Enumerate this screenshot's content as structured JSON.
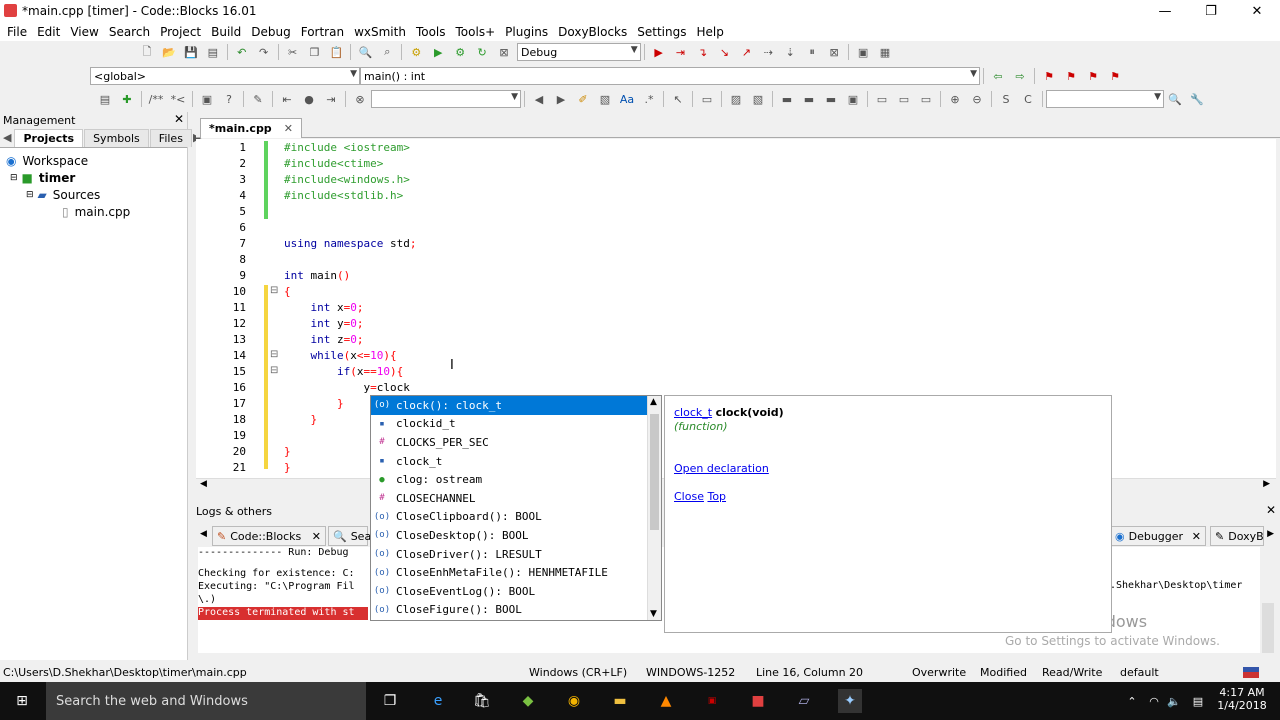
{
  "window": {
    "title": "*main.cpp [timer] - Code::Blocks 16.01",
    "minimize": "—",
    "maximize": "❐",
    "close": "✕"
  },
  "menu": [
    "File",
    "Edit",
    "View",
    "Search",
    "Project",
    "Build",
    "Debug",
    "Fortran",
    "wxSmith",
    "Tools",
    "Tools+",
    "Plugins",
    "DoxyBlocks",
    "Settings",
    "Help"
  ],
  "toolbar": {
    "build_target": "Debug",
    "scope": "<global>",
    "function": "main() : int"
  },
  "management": {
    "title": "Management",
    "tabs": [
      "Projects",
      "Symbols",
      "Files"
    ],
    "tree": {
      "workspace": "Workspace",
      "project": "timer",
      "folder": "Sources",
      "file": "main.cpp"
    }
  },
  "editor": {
    "tab": "*main.cpp",
    "lines": [
      {
        "n": "1",
        "html": "<span class='pp'>#include &lt;iostream&gt;</span>"
      },
      {
        "n": "2",
        "html": "<span class='pp'>#include&lt;ctime&gt;</span>"
      },
      {
        "n": "3",
        "html": "<span class='pp'>#include&lt;windows.h&gt;</span>"
      },
      {
        "n": "4",
        "html": "<span class='pp'>#include&lt;stdlib.h&gt;</span>"
      },
      {
        "n": "5",
        "html": ""
      },
      {
        "n": "6",
        "html": ""
      },
      {
        "n": "7",
        "html": "<span class='kw'>using namespace</span> std<span class='op'>;</span>"
      },
      {
        "n": "8",
        "html": ""
      },
      {
        "n": "9",
        "html": "<span class='kw'>int</span> main<span class='op'>()</span>"
      },
      {
        "n": "10",
        "html": "<span class='op'>{</span>"
      },
      {
        "n": "11",
        "html": "    <span class='kw'>int</span> x<span class='op'>=</span><span class='num'>0</span><span class='op'>;</span>"
      },
      {
        "n": "12",
        "html": "    <span class='kw'>int</span> y<span class='op'>=</span><span class='num'>0</span><span class='op'>;</span>"
      },
      {
        "n": "13",
        "html": "    <span class='kw'>int</span> z<span class='op'>=</span><span class='num'>0</span><span class='op'>;</span>"
      },
      {
        "n": "14",
        "html": "    <span class='kw'>while</span><span class='op'>(</span>x<span class='op'>&lt;=</span><span class='num'>10</span><span class='op'>){</span>"
      },
      {
        "n": "15",
        "html": "        <span class='kw'>if</span><span class='op'>(</span>x<span class='op'>==</span><span class='num'>10</span><span class='op'>){</span>"
      },
      {
        "n": "16",
        "html": "            y<span class='op'>=</span>clock"
      },
      {
        "n": "17",
        "html": "        <span class='op'>}</span>"
      },
      {
        "n": "18",
        "html": "    <span class='op'>}</span>"
      },
      {
        "n": "19",
        "html": ""
      },
      {
        "n": "20",
        "html": "<span class='op'>}</span>"
      },
      {
        "n": "21",
        "html": "<span class='op'>}</span>"
      }
    ]
  },
  "completion": {
    "items": [
      {
        "icon": "(o)",
        "label": "clock(): clock_t",
        "selected": true
      },
      {
        "icon": "▪",
        "label": "clockid_t"
      },
      {
        "icon": "#",
        "label": "CLOCKS_PER_SEC"
      },
      {
        "icon": "▪",
        "label": "clock_t"
      },
      {
        "icon": "●",
        "label": "clog: ostream"
      },
      {
        "icon": "#",
        "label": "CLOSECHANNEL"
      },
      {
        "icon": "(o)",
        "label": "CloseClipboard(): BOOL"
      },
      {
        "icon": "(o)",
        "label": "CloseDesktop(): BOOL"
      },
      {
        "icon": "(o)",
        "label": "CloseDriver(): LRESULT"
      },
      {
        "icon": "(o)",
        "label": "CloseEnhMetaFile(): HENHMETAFILE"
      },
      {
        "icon": "(o)",
        "label": "CloseEventLog(): BOOL"
      },
      {
        "icon": "(o)",
        "label": "CloseFigure(): BOOL"
      }
    ],
    "doc": {
      "type_link": "clock_t",
      "signature": "clock(void)",
      "kind": "(function)",
      "open_decl": "Open declaration",
      "close": "Close",
      "top": "Top"
    }
  },
  "logs": {
    "title": "Logs & others",
    "tabs": [
      "Code::Blocks",
      "Sea",
      "Debugger",
      "DoxyB"
    ],
    "lines": [
      "-------------- Run: Debug",
      "Checking for existence: C:",
      "Executing: \"C:\\Program Fil",
      "\\.)",
      "Process terminated with st"
    ],
    "right_path": ".Shekhar\\Desktop\\timer"
  },
  "status": {
    "path": "C:\\Users\\D.Shekhar\\Desktop\\timer\\main.cpp",
    "eol": "Windows (CR+LF)",
    "encoding": "WINDOWS-1252",
    "position": "Line 16, Column 20",
    "mode": "Overwrite",
    "modified": "Modified",
    "access": "Read/Write",
    "profile": "default"
  },
  "watermark": {
    "line1": "Activate Windows",
    "line2": "Go to Settings to activate Windows."
  },
  "taskbar": {
    "search": "Search the web and Windows",
    "time": "4:17 AM",
    "date": "1/4/2018"
  }
}
